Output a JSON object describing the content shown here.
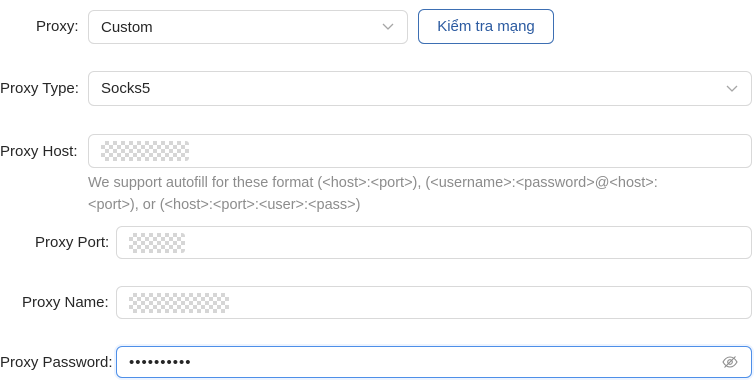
{
  "proxy": {
    "label": "Proxy",
    "separator": ":",
    "selected": "Custom",
    "check_network_button": "Kiểm tra mạng"
  },
  "proxy_type": {
    "label": "Proxy Type",
    "separator": ":",
    "selected": "Socks5"
  },
  "proxy_host": {
    "label": "Proxy Host",
    "separator": ":",
    "hint_line1": "We support autofill for these format (<host>:<port>), (<username>:<password>@<host>:",
    "hint_line2": "<port>), or (<host>:<port>:<user>:<pass>)"
  },
  "proxy_port": {
    "label": "Proxy Port",
    "separator": ":"
  },
  "proxy_name": {
    "label": "Proxy Name",
    "separator": ":"
  },
  "proxy_password": {
    "label": "Proxy Password",
    "separator": ":",
    "value": "••••••••••"
  },
  "icons": {
    "dropdown": "chevron-down-icon",
    "visibility": "eye-slash-icon"
  },
  "colors": {
    "accent": "#2b5aa0",
    "focus_border": "#4e8fe8",
    "hint": "#8c8c8c"
  }
}
